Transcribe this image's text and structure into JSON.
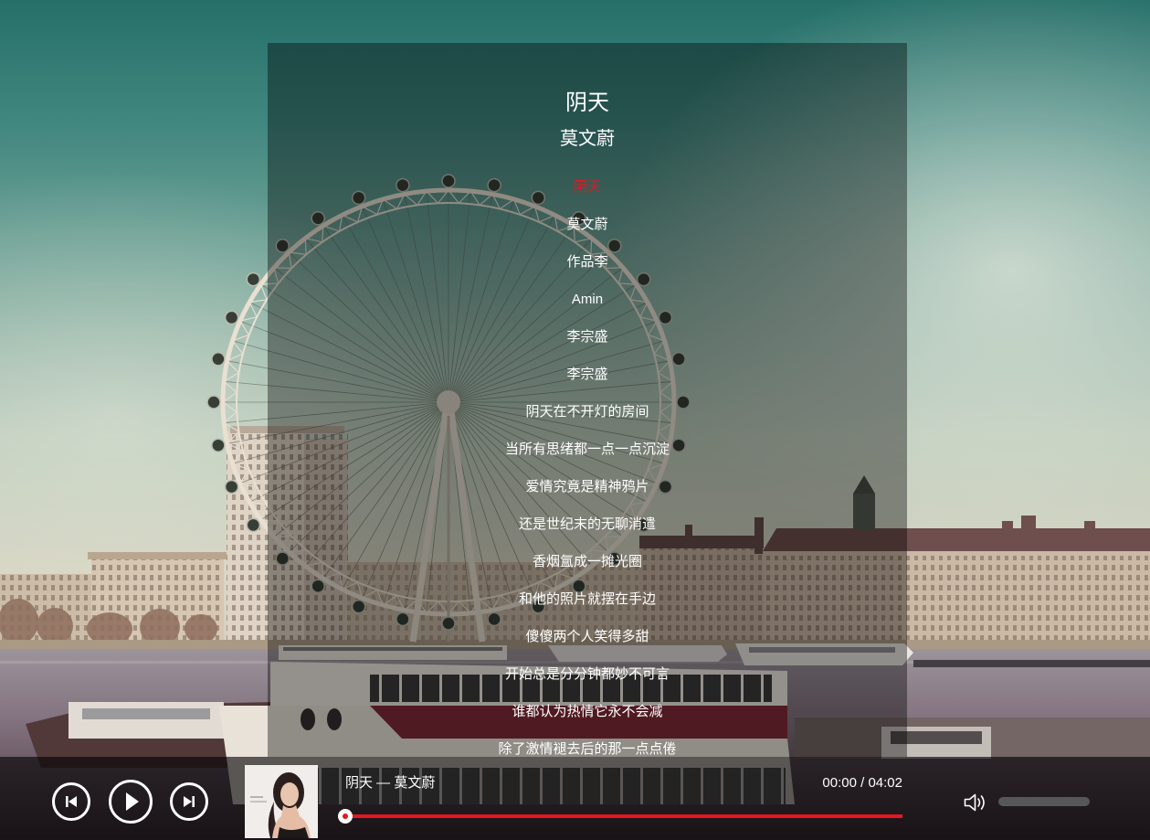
{
  "player": {
    "title": "阴天",
    "artist": "莫文蔚",
    "current_lyric_index": 0,
    "lyrics": [
      "阴天",
      "莫文蔚",
      "作品李",
      "Amin",
      "李宗盛",
      "李宗盛",
      "阴天在不开灯的房间",
      "当所有思绪都一点一点沉淀",
      "爱情究竟是精神鸦片",
      "还是世纪末的无聊消遣",
      "香烟氲成一摊光圈",
      "和他的照片就摆在手边",
      "傻傻两个人笑得多甜",
      "开始总是分分钟都妙不可言",
      "谁都认为热情它永不会减",
      "除了激情褪去后的那一点点倦"
    ]
  },
  "controls": {
    "prev": {
      "icon": "skip-previous-icon"
    },
    "play": {
      "icon": "play-icon"
    },
    "next": {
      "icon": "skip-next-icon"
    },
    "volume": {
      "icon": "volume-icon"
    }
  },
  "now_playing": {
    "label": "阴天 — 莫文蔚",
    "current_time": "00:00",
    "separator": "/",
    "duration": "04:02",
    "progress": 0
  },
  "colors": {
    "accent": "#e3171f",
    "text": "#ffffff"
  }
}
